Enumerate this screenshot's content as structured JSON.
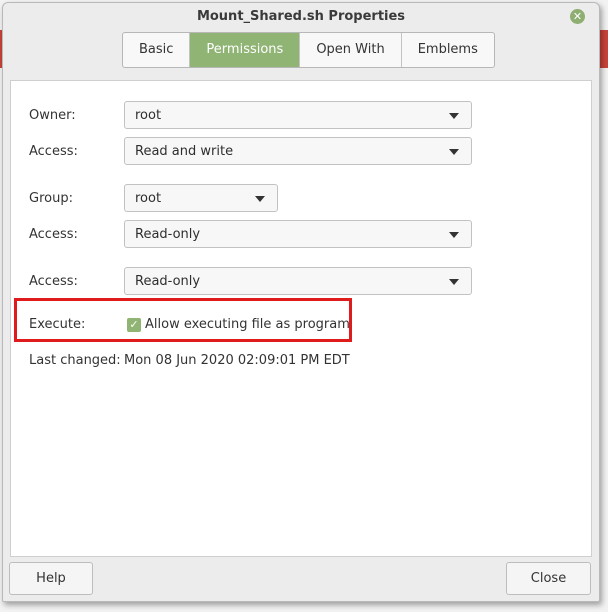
{
  "window": {
    "title": "Mount_Shared.sh Properties"
  },
  "tabs": [
    {
      "label": "Basic"
    },
    {
      "label": "Permissions"
    },
    {
      "label": "Open With"
    },
    {
      "label": "Emblems"
    }
  ],
  "permissions": {
    "owner_label": "Owner:",
    "owner_value": "root",
    "owner_access_label": "Access:",
    "owner_access_value": "Read and write",
    "group_label": "Group:",
    "group_value": "root",
    "group_access_label": "Access:",
    "group_access_value": "Read-only",
    "others_access_label": "Access:",
    "others_access_value": "Read-only",
    "execute_label": "Execute:",
    "execute_checkbox_label": "Allow executing file as program",
    "execute_checked": true,
    "last_changed_label": "Last changed:",
    "last_changed_value": "Mon 08 Jun 2020 02:09:01 PM EDT"
  },
  "footer": {
    "help_label": "Help",
    "close_label": "Close"
  },
  "colors": {
    "accent": "#8fb474",
    "highlight": "#e01b1b"
  }
}
